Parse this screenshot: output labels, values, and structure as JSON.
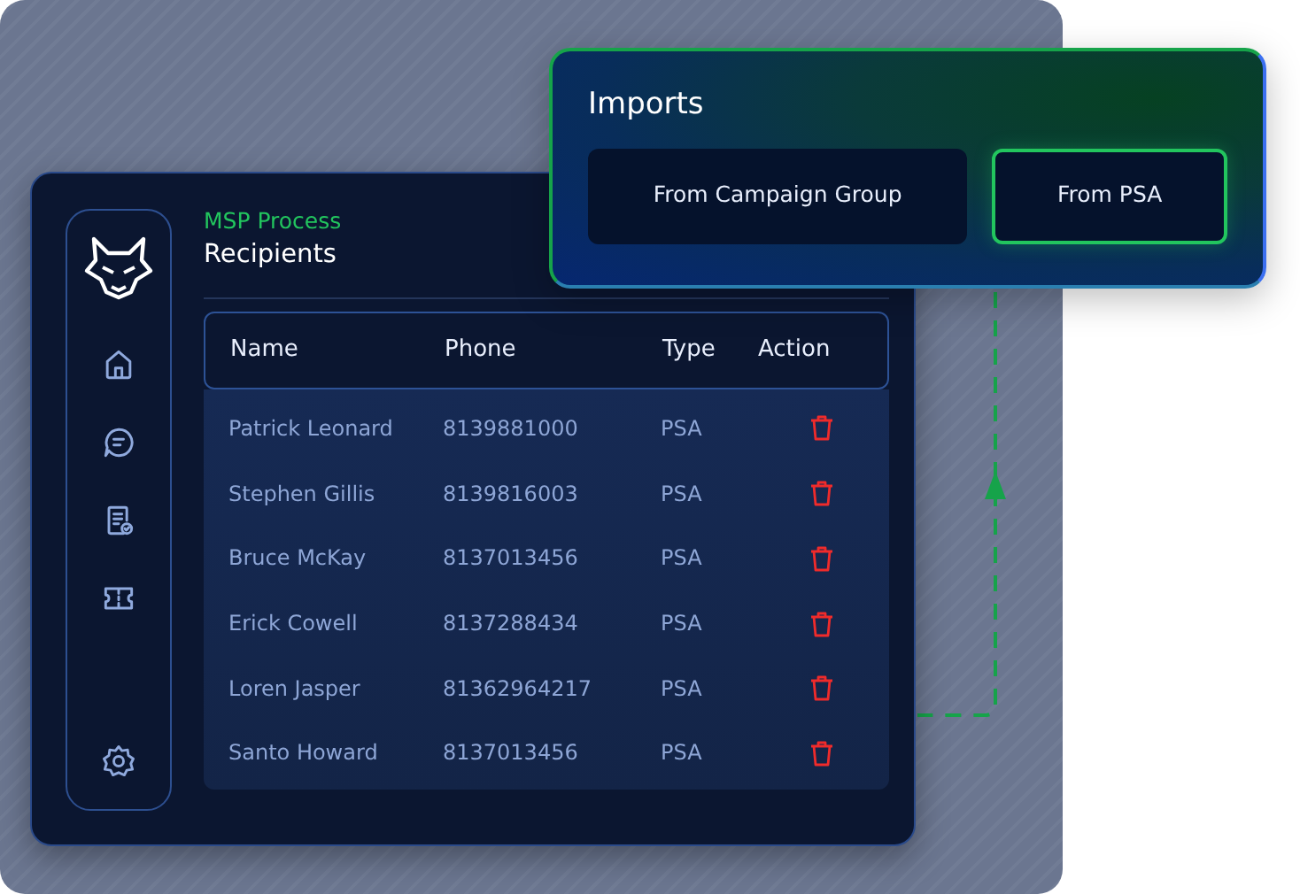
{
  "app": {
    "section": "MSP Process",
    "title": "Recipients"
  },
  "sidebar": {
    "items": [
      {
        "kind": "home",
        "selected": false
      },
      {
        "kind": "chat",
        "selected": false
      },
      {
        "kind": "report",
        "selected": false
      },
      {
        "kind": "ticket",
        "selected": false
      },
      {
        "kind": "settings",
        "selected": false
      }
    ]
  },
  "table": {
    "columns": [
      "Name",
      "Phone",
      "Type",
      "Action"
    ],
    "rows": [
      {
        "name": "Patrick Leonard",
        "phone": "8139881000",
        "type": "PSA"
      },
      {
        "name": "Stephen Gillis",
        "phone": "8139816003",
        "type": "PSA"
      },
      {
        "name": "Bruce McKay",
        "phone": "8137013456",
        "type": "PSA"
      },
      {
        "name": "Erick Cowell",
        "phone": "8137288434",
        "type": "PSA"
      },
      {
        "name": "Loren Jasper",
        "phone": "81362964217",
        "type": "PSA"
      },
      {
        "name": "Santo Howard",
        "phone": "8137013456",
        "type": "PSA"
      }
    ]
  },
  "imports": {
    "title": "Imports",
    "buttons": [
      {
        "label": "From Campaign Group",
        "selected": false
      },
      {
        "label": "From PSA",
        "selected": true
      }
    ]
  }
}
